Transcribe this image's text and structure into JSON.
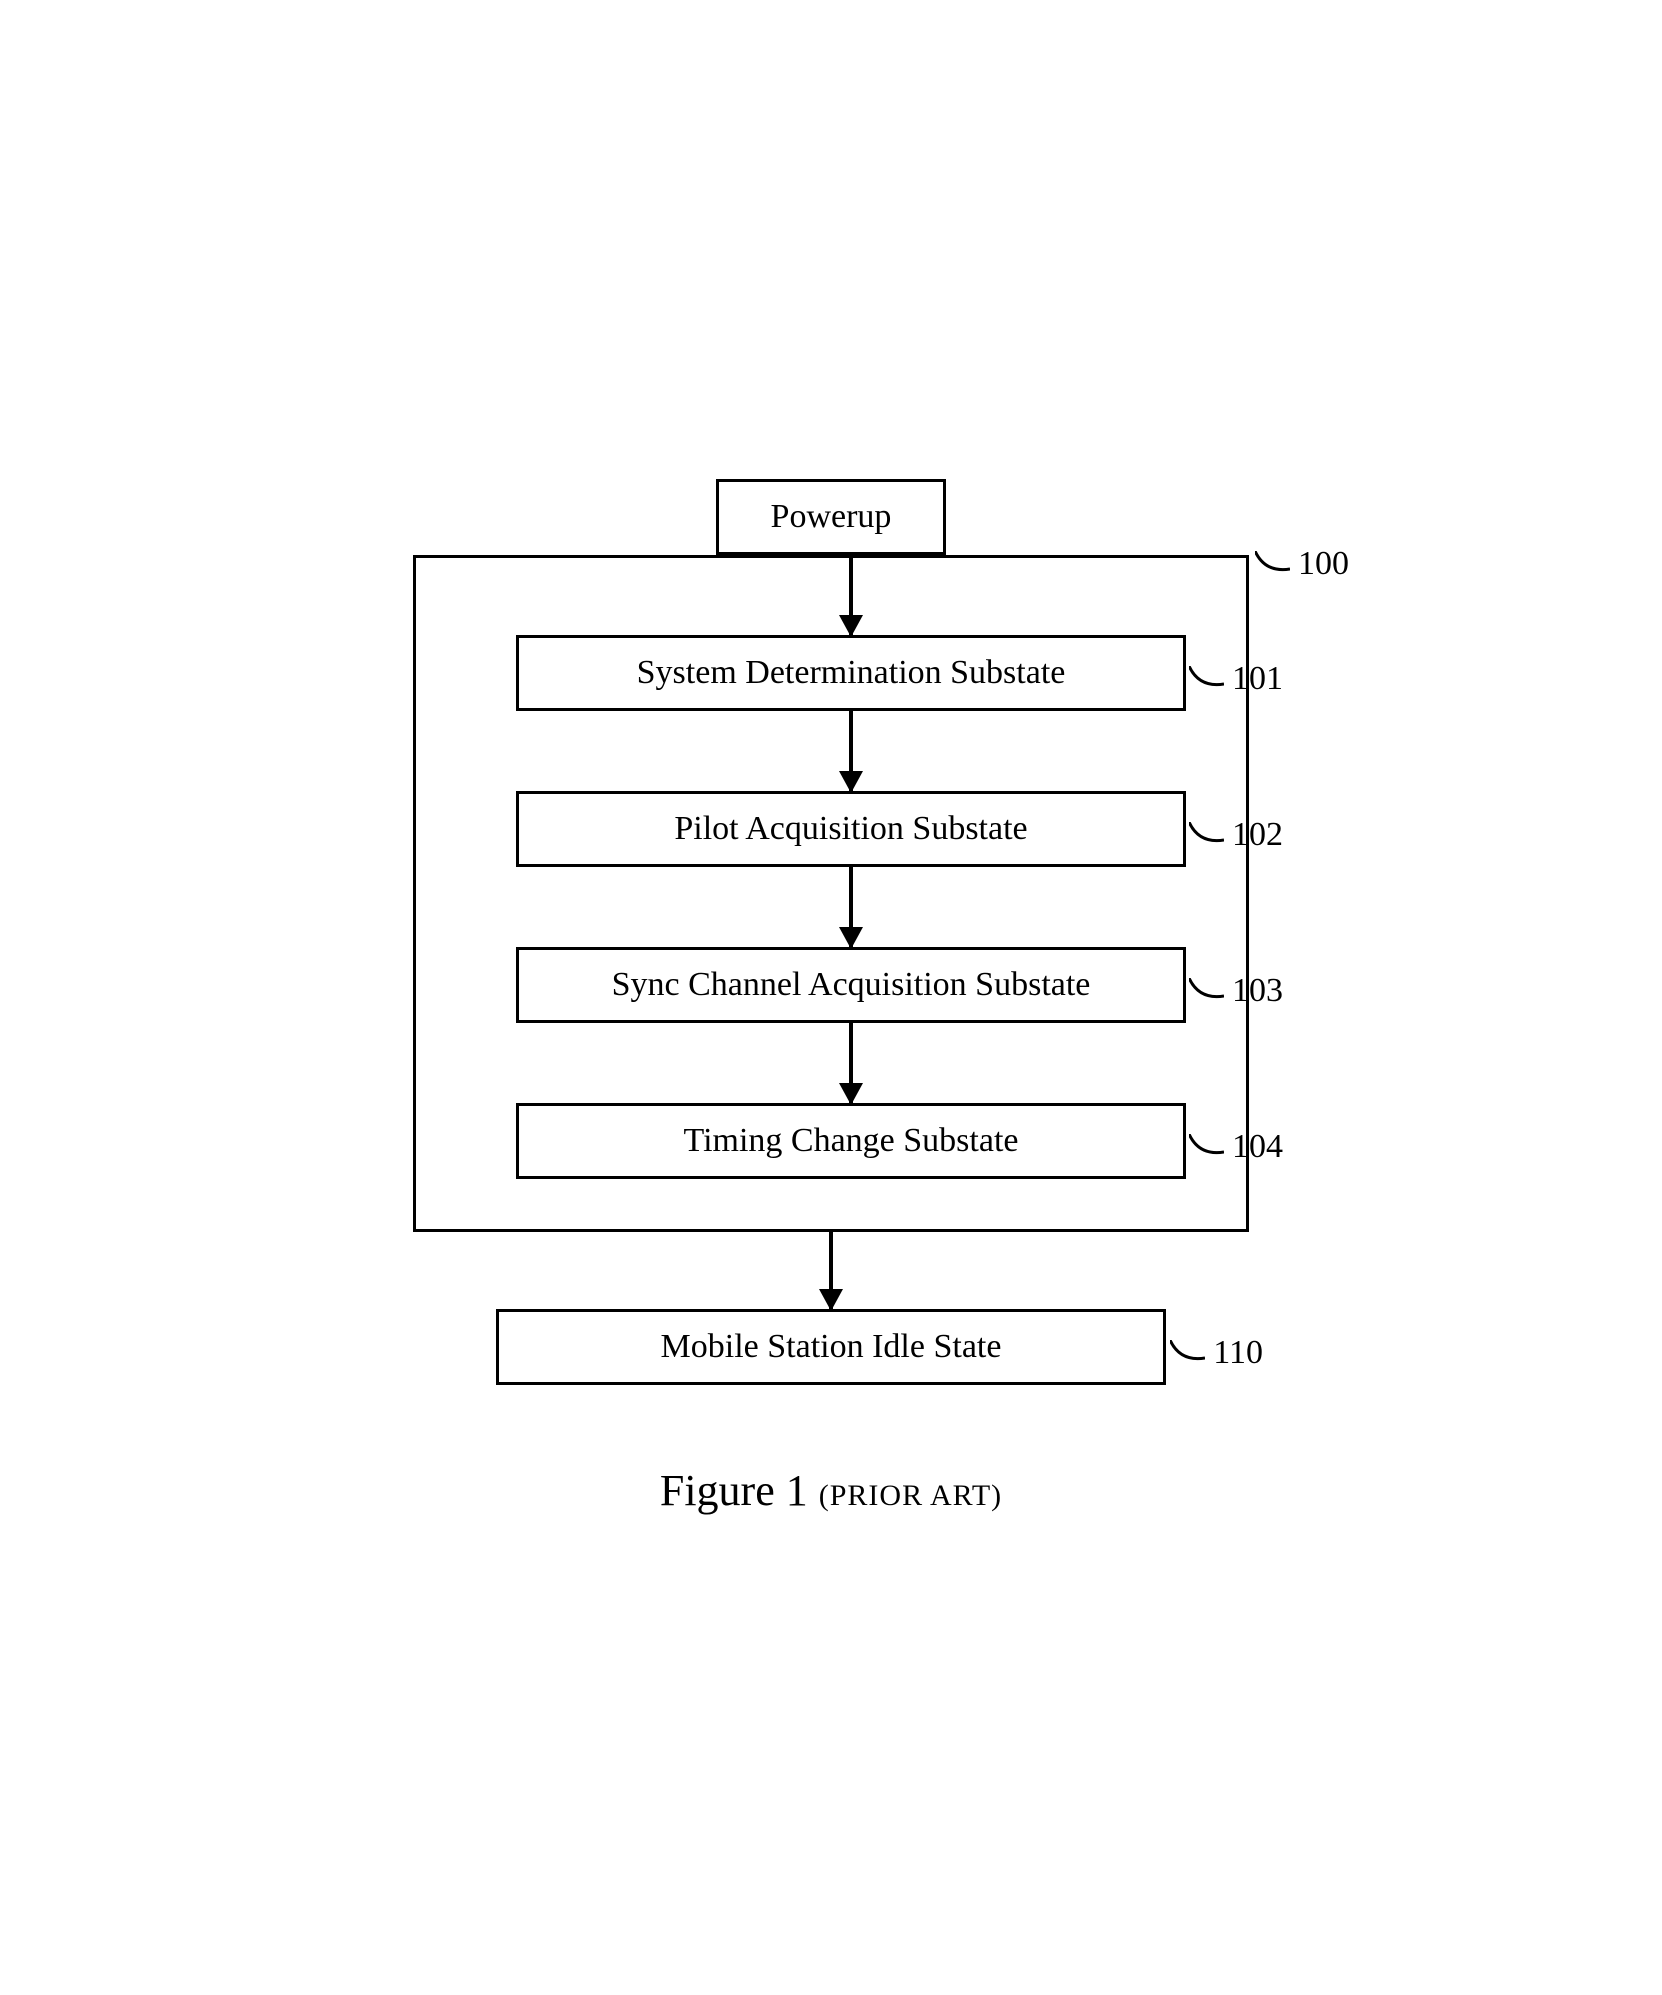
{
  "boxes": {
    "powerup": "Powerup",
    "substates": [
      "System Determination Substate",
      "Pilot Acquisition Substate",
      "Sync Channel Acquisition Substate",
      "Timing Change Substate"
    ],
    "final": "Mobile Station Idle State"
  },
  "labels": {
    "group": "100",
    "substate_numbers": [
      "101",
      "102",
      "103",
      "104"
    ],
    "final": "110"
  },
  "caption": {
    "main": "Figure 1",
    "note": "(PRIOR ART)"
  }
}
